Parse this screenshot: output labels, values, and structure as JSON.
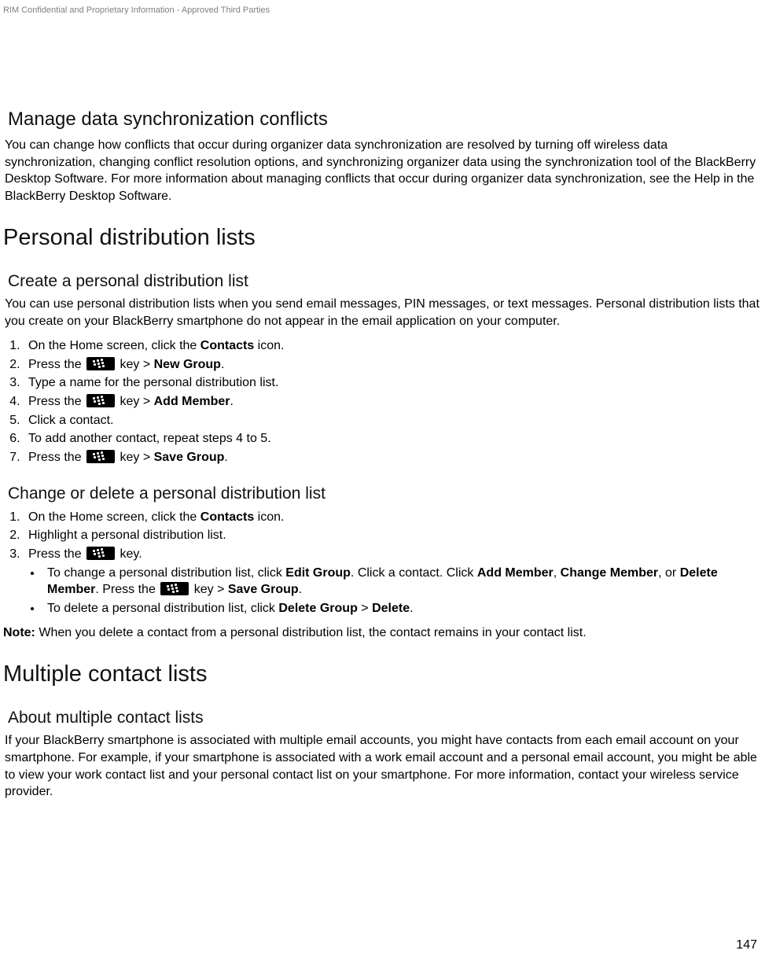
{
  "header": {
    "confidential": "RIM Confidential and Proprietary Information - Approved Third Parties"
  },
  "s1": {
    "title": "Manage data synchronization conflicts",
    "body": "You can change how conflicts that occur during organizer data synchronization are resolved by turning off wireless data synchronization, changing conflict resolution options, and synchronizing organizer data using the synchronization tool of the BlackBerry Desktop Software. For more information about managing conflicts that occur during organizer data synchronization, see the Help in the BlackBerry Desktop Software."
  },
  "s2": {
    "title": "Personal distribution lists",
    "create": {
      "title": "Create a personal distribution list",
      "intro": "You can use personal distribution lists when you send email messages, PIN messages, or text messages. Personal distribution lists that you create on your BlackBerry smartphone do not appear in the email application on your computer.",
      "steps": {
        "s1a": "On the Home screen, click the ",
        "s1b": "Contacts",
        "s1c": " icon.",
        "s2a": "Press the ",
        "s2b": " key > ",
        "s2c": "New Group",
        "s2d": ".",
        "s3": "Type a name for the personal distribution list.",
        "s4a": "Press the ",
        "s4b": " key > ",
        "s4c": "Add Member",
        "s4d": ".",
        "s5": "Click a contact.",
        "s6": "To add another contact, repeat steps 4 to 5.",
        "s7a": "Press the ",
        "s7b": " key > ",
        "s7c": "Save Group",
        "s7d": "."
      }
    },
    "change": {
      "title": "Change or delete a personal distribution list",
      "steps": {
        "s1a": "On the Home screen, click the ",
        "s1b": "Contacts",
        "s1c": " icon.",
        "s2": "Highlight a personal distribution list.",
        "s3a": "Press the ",
        "s3b": " key.",
        "b1a": "To change a personal distribution list, click ",
        "b1b": "Edit Group",
        "b1c": ". Click a contact. Click ",
        "b1d": "Add Member",
        "b1e": ", ",
        "b1f": "Change Member",
        "b1g": ", or ",
        "b1h": "Delete Member",
        "b1i": ". Press the ",
        "b1j": " key > ",
        "b1k": "Save Group",
        "b1l": ".",
        "b2a": "To delete a personal distribution list, click ",
        "b2b": "Delete Group",
        "b2c": " > ",
        "b2d": "Delete",
        "b2e": "."
      },
      "note_label": "Note:",
      "note_body": " When you delete a contact from a personal distribution list, the contact remains in your contact list."
    }
  },
  "s3": {
    "title": "Multiple contact lists",
    "about": {
      "title": "About multiple contact lists",
      "body": "If your BlackBerry smartphone is associated with multiple email accounts, you might have contacts from each email account on your smartphone. For example, if your smartphone is associated with a work email account and a personal email account, you might be able to view your work contact list and your personal contact list on your smartphone. For more information, contact your wireless service provider."
    }
  },
  "page_number": "147"
}
